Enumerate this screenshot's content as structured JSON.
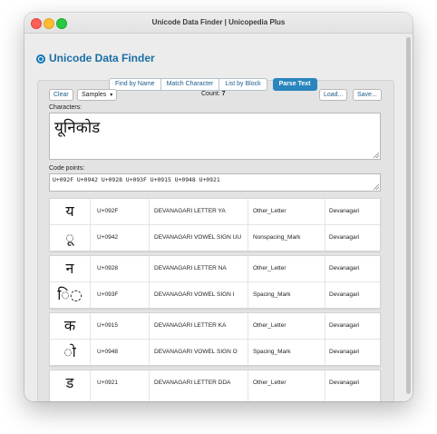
{
  "window": {
    "title": "Unicode Data Finder | Unicopedia Plus"
  },
  "heading": "Unicode Data Finder",
  "tabs": [
    {
      "label": "Find by Name",
      "selected": false
    },
    {
      "label": "Match Character",
      "selected": false
    },
    {
      "label": "List by Block",
      "selected": false
    },
    {
      "label": "Parse Text",
      "selected": true
    }
  ],
  "toolbar": {
    "clear_label": "Clear",
    "samples_label": "Samples",
    "samples_arrow": "▾",
    "count_label": "Count:",
    "count_value": "7",
    "load_label": "Load...",
    "save_label": "Save..."
  },
  "characters": {
    "label": "Characters:",
    "value": "यूनिकोड"
  },
  "code_points": {
    "label": "Code points:",
    "value": "U+092F U+0942 U+0928 U+093F U+0915 U+0948 U+0921"
  },
  "groups": [
    [
      {
        "glyph": "य",
        "code": "U+092F",
        "name": "DEVANAGARI LETTER YA",
        "category": "Other_Letter",
        "script": "Devanagari"
      },
      {
        "glyph": "◌ू",
        "code": "U+0942",
        "name": "DEVANAGARI VOWEL SIGN UU",
        "category": "Nonspacing_Mark",
        "script": "Devanagari"
      }
    ],
    [
      {
        "glyph": "न",
        "code": "U+0928",
        "name": "DEVANAGARI LETTER NA",
        "category": "Other_Letter",
        "script": "Devanagari"
      },
      {
        "glyph": "ि◌",
        "code": "U+093F",
        "name": "DEVANAGARI VOWEL SIGN I",
        "category": "Spacing_Mark",
        "script": "Devanagari"
      }
    ],
    [
      {
        "glyph": "क",
        "code": "U+0915",
        "name": "DEVANAGARI LETTER KA",
        "category": "Other_Letter",
        "script": "Devanagari"
      },
      {
        "glyph": "◌ो",
        "code": "U+0948",
        "name": "DEVANAGARI VOWEL SIGN O",
        "category": "Spacing_Mark",
        "script": "Devanagari"
      }
    ],
    [
      {
        "glyph": "ड",
        "code": "U+0921",
        "name": "DEVANAGARI LETTER DDA",
        "category": "Other_Letter",
        "script": "Devanagari"
      }
    ]
  ]
}
